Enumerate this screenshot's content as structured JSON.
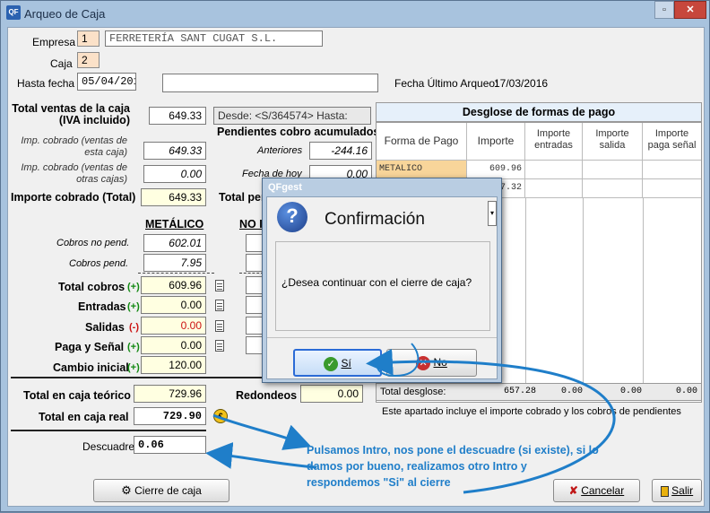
{
  "window": {
    "title": "Arqueo de Caja",
    "logo": "QF",
    "min_label": "▫",
    "close_label": "✕"
  },
  "header": {
    "empresa_label": "Empresa",
    "empresa_code": "1",
    "empresa_name": "FERRETERÍA SANT CUGAT S.L.",
    "caja_label": "Caja",
    "caja_code": "2",
    "hasta_fecha_label": "Hasta fecha",
    "hasta_fecha_value": "05/04/2016",
    "fecha_ultimo_arqueo_label": "Fecha Último Arqueo:",
    "fecha_ultimo_arqueo_value": "17/03/2016"
  },
  "ventas": {
    "total_ventas_label": "Total ventas de la caja\n(IVA incluido)",
    "total_ventas_value": "649.33",
    "desde_text": "Desde: <S/364574> Hasta:",
    "imp_cobrado_esta_label": "Imp. cobrado (ventas de\nesta caja)",
    "imp_cobrado_esta_value": "649.33",
    "imp_cobrado_otras_label": "Imp. cobrado (ventas de\notras cajas)",
    "imp_cobrado_otras_value": "0.00",
    "importe_cobrado_label": "Importe cobrado (Total)",
    "importe_cobrado_value": "649.33"
  },
  "pendientes": {
    "title": "Pendientes cobro acumulados:",
    "anteriores_label": "Anteriores",
    "anteriores_value": "-244.16",
    "fecha_hoy_label": "Fecha de hoy",
    "fecha_hoy_value": "0.00",
    "total_pend_label": "Total per"
  },
  "metalico": {
    "title": "METÁLICO",
    "no_title": "NO I",
    "cobros_no_pend_label": "Cobros no pend.",
    "cobros_no_pend_value": "602.01",
    "cobros_pend_label": "Cobros pend.",
    "cobros_pend_value": "7.95",
    "total_cobros_label": "Total cobros",
    "total_cobros_value": "609.96",
    "total_cobros_sign": "(+)",
    "entradas_label": "Entradas",
    "entradas_value": "0.00",
    "entradas_sign": "(+)",
    "salidas_label": "Salidas",
    "salidas_value": "0.00",
    "salidas_sign": "(-)",
    "paga_senal_label": "Paga y Señal",
    "paga_senal_value": "0.00",
    "paga_senal_sign": "(+)",
    "cambio_inicial_label": "Cambio inicial",
    "cambio_inicial_value": "120.00",
    "cambio_inicial_sign": "(+)"
  },
  "totales": {
    "total_teorico_label": "Total en caja teórico",
    "total_teorico_value": "729.96",
    "redondeos_label": "Redondeos",
    "redondeos_value": "0.00",
    "total_real_label": "Total en caja real",
    "total_real_value": "729.90",
    "descuadre_label": "Descuadre",
    "descuadre_value": "0.06"
  },
  "desglose": {
    "title": "Desglose de formas de pago",
    "columns": [
      "Forma de Pago",
      "Importe",
      "Importe\nentradas",
      "Importe\nsalida",
      "Importe\npaga señal"
    ],
    "rows": [
      {
        "forma": "METALICO",
        "importe": "609.96"
      },
      {
        "forma": "",
        "importe": "57.32"
      }
    ],
    "total_label": "Total desglose:",
    "total_importe": "657.28",
    "total_entradas": "0.00",
    "total_salida": "0.00",
    "total_paga": "0.00",
    "note": "Este apartado incluye el importe cobrado y los cobros de pendientes"
  },
  "dialog": {
    "window_title": "QFgest",
    "heading": "Confirmación",
    "message": "¿Desea continuar con el cierre de caja?",
    "yes_label": "Sí",
    "no_label": "No"
  },
  "annotation": {
    "text": "Pulsamos Intro, nos pone el descuadre (si existe), si lo damos por bueno, realizamos otro Intro y respondemos \"Si\" al cierre"
  },
  "buttons": {
    "cierre_label": "Cierre de caja",
    "cancelar_label": "Cancelar",
    "salir_label": "Salir"
  },
  "colors": {
    "accent": "#1f7ec9",
    "green_sign": "#118811",
    "red_sign": "#cc1111"
  }
}
